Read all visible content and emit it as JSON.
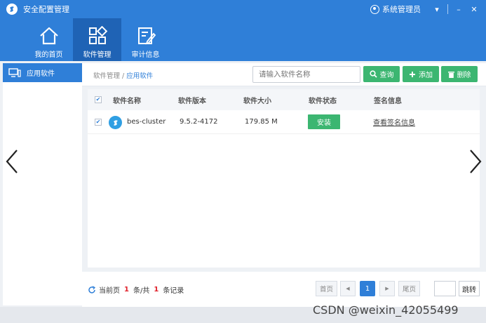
{
  "app": {
    "title": "安全配置管理",
    "user": "系统管理员"
  },
  "window_controls": {
    "menu": "▾",
    "minimize": "–",
    "close": "✕"
  },
  "nav": [
    {
      "label": "我的首页",
      "icon": "home-icon"
    },
    {
      "label": "软件管理",
      "icon": "apps-grid-icon",
      "active": true
    },
    {
      "label": "审计信息",
      "icon": "audit-edit-icon"
    }
  ],
  "sidebar": {
    "items": [
      {
        "label": "应用软件",
        "icon": "monitor-icon",
        "active": true
      }
    ]
  },
  "breadcrumb": {
    "parent": "软件管理",
    "separator": "/",
    "current": "应用软件"
  },
  "search": {
    "placeholder": "请输入软件名称"
  },
  "buttons": {
    "query": "查询",
    "add": "添加",
    "delete": "删除"
  },
  "table": {
    "headers": [
      "软件名称",
      "软件版本",
      "软件大小",
      "软件状态",
      "签名信息"
    ],
    "rows": [
      {
        "name": "bes-cluster",
        "version": "9.5.2-4172",
        "size": "179.85 M",
        "status": "安装",
        "signature": "查看签名信息",
        "checked": true
      }
    ]
  },
  "pagination": {
    "current_label": "当前页",
    "current_count": "1",
    "unit_total": "条/共",
    "total": "1",
    "records": "条记录",
    "first": "首页",
    "prev": "◀",
    "page": "1",
    "next": "▶",
    "last": "尾页",
    "jump": "跳转"
  },
  "watermark": "CSDN @weixin_42055499",
  "colors": {
    "primary": "#2f7fd8",
    "nav_active": "#1f63b5",
    "success": "#3cb671",
    "danger_text": "#e0202a"
  }
}
